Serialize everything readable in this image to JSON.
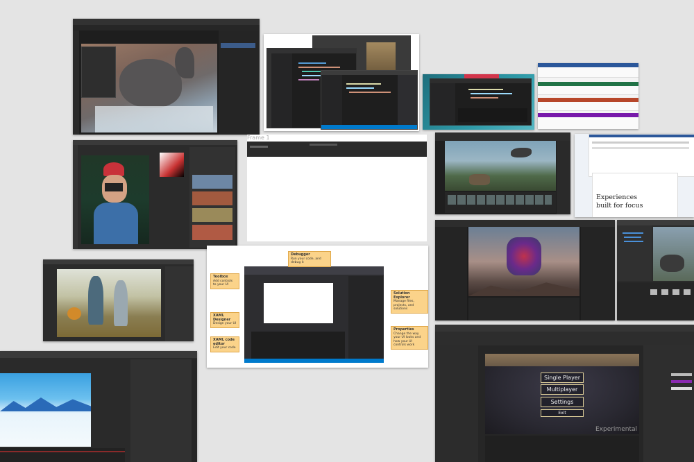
{
  "frame_label": "Frame 1",
  "vs_callouts": [
    {
      "title": "Debugger",
      "desc": "Run your code, and debug it"
    },
    {
      "title": "Toolbox",
      "desc": "Add controls to your UI"
    },
    {
      "title": "Solution Explorer",
      "desc": "Manage files, projects, and solutions"
    },
    {
      "title": "XAML Designer",
      "desc": "Design your UI"
    },
    {
      "title": "Properties",
      "desc": "Change the way your UI looks and how your UI controls work"
    },
    {
      "title": "XAML code editor",
      "desc": "Edit your code"
    }
  ],
  "office_hero_text": "Experiences built for focus",
  "game_menu": {
    "buttons": [
      "Single Player",
      "Multiplayer",
      "Settings",
      "Exit"
    ],
    "watermark": "Experimental"
  },
  "colors": {
    "background": "#e4e4e4",
    "callout": "#fbd38a",
    "vs_accent": "#007acc",
    "word": "#2b579a",
    "excel": "#217346",
    "powerpoint": "#b7472a",
    "onenote": "#7719aa"
  }
}
